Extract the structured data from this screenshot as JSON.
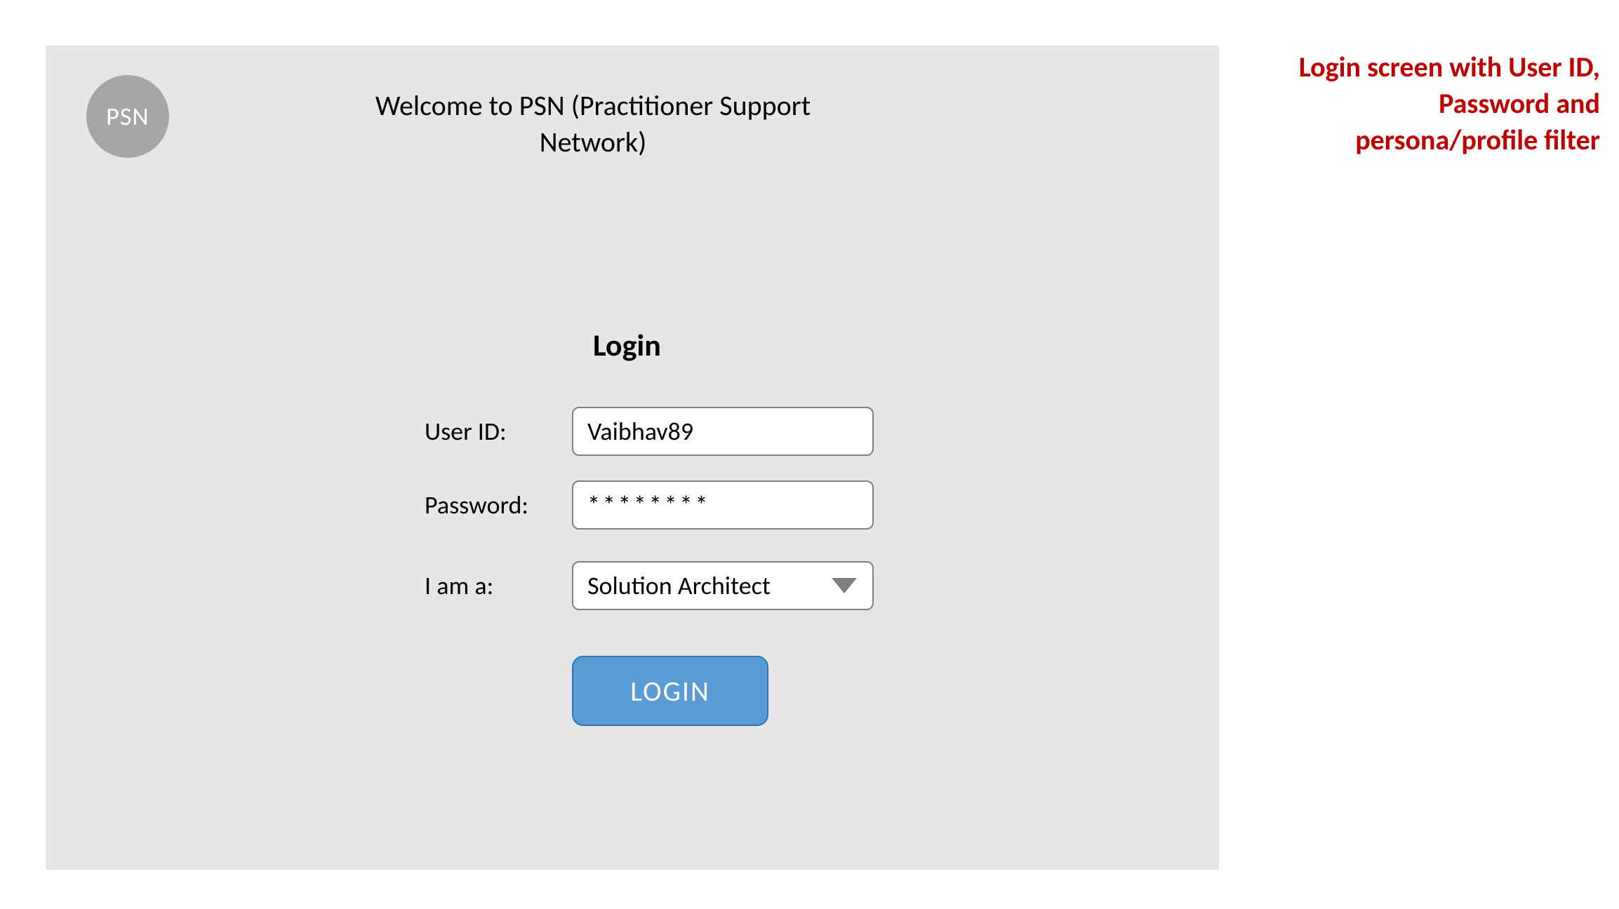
{
  "logo": {
    "text": "PSN"
  },
  "header": {
    "welcome": "Welcome to PSN (Practitioner Support Network)"
  },
  "login": {
    "heading": "Login",
    "user_label": "User ID:",
    "user_value": "Vaibhav89",
    "password_label": "Password:",
    "password_value": "********",
    "persona_label": "I am a:",
    "persona_value": "Solution Architect",
    "button_label": "LOGIN"
  },
  "annotation": {
    "text": "Login screen with User ID, Password and persona/profile filter"
  }
}
